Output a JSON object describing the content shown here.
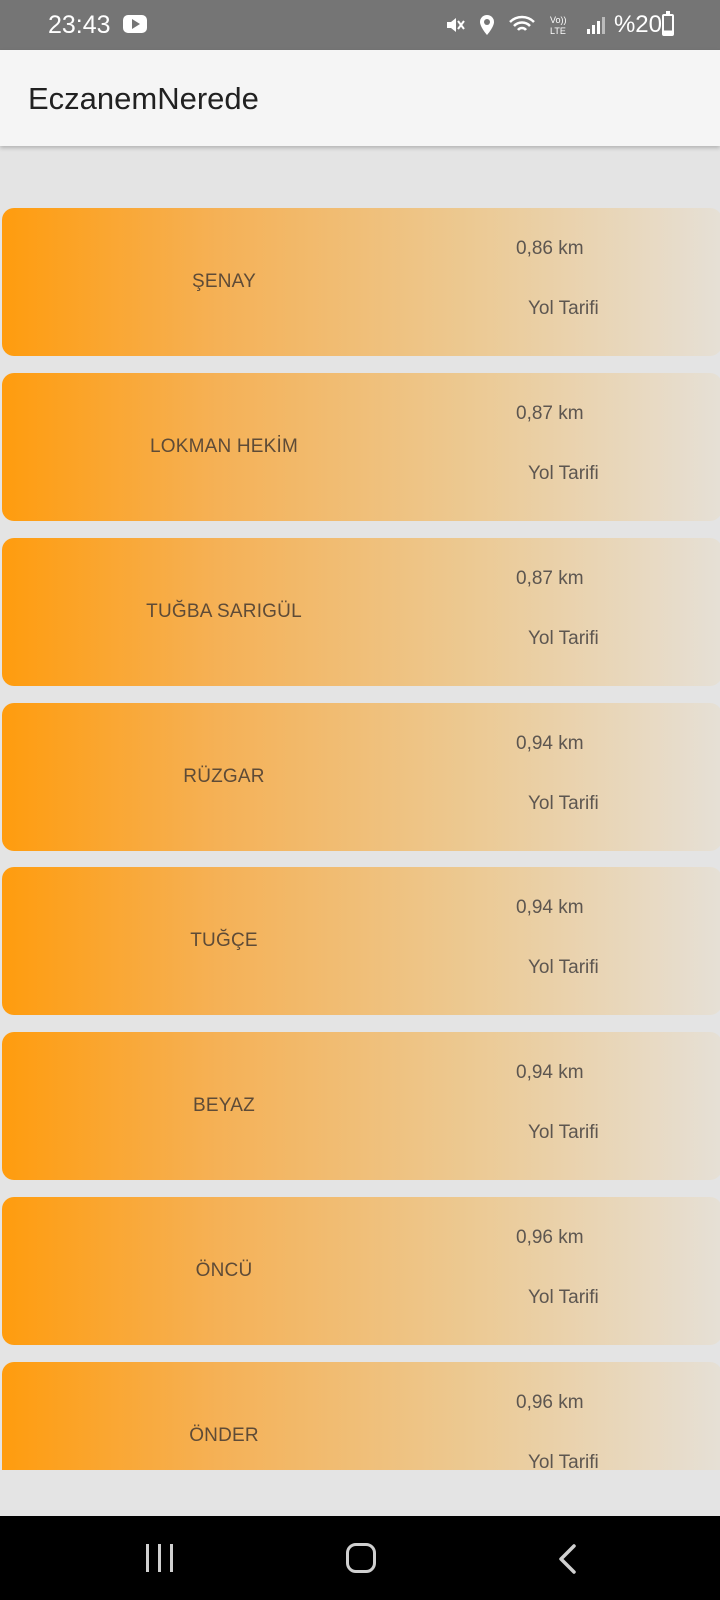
{
  "status_bar": {
    "time": "23:43",
    "battery": "%20",
    "icons": [
      "youtube-icon",
      "mute-icon",
      "location-icon",
      "wifi-icon",
      "volte-icon",
      "signal-icon",
      "battery-icon"
    ]
  },
  "app_bar": {
    "title": "EczanemNerede"
  },
  "pharmacies": [
    {
      "name": "ŞENAY",
      "distance": "0,86 km",
      "directions": "Yol Tarifi"
    },
    {
      "name": "LOKMAN HEKİM",
      "distance": "0,87 km",
      "directions": "Yol Tarifi"
    },
    {
      "name": "TUĞBA SARIGÜL",
      "distance": "0,87 km",
      "directions": "Yol Tarifi"
    },
    {
      "name": "RÜZGAR",
      "distance": "0,94 km",
      "directions": "Yol Tarifi"
    },
    {
      "name": "TUĞÇE",
      "distance": "0,94 km",
      "directions": "Yol Tarifi"
    },
    {
      "name": "BEYAZ",
      "distance": "0,94 km",
      "directions": "Yol Tarifi"
    },
    {
      "name": "ÖNCÜ",
      "distance": "0,96 km",
      "directions": "Yol Tarifi"
    },
    {
      "name": "ÖNDER",
      "distance": "0,96 km",
      "directions": "Yol Tarifi"
    }
  ],
  "colors": {
    "card_gradient_start": "#ff9c0e",
    "card_gradient_end": "#e6e0d6",
    "background": "#e4e4e4",
    "status_bar": "#757575"
  }
}
